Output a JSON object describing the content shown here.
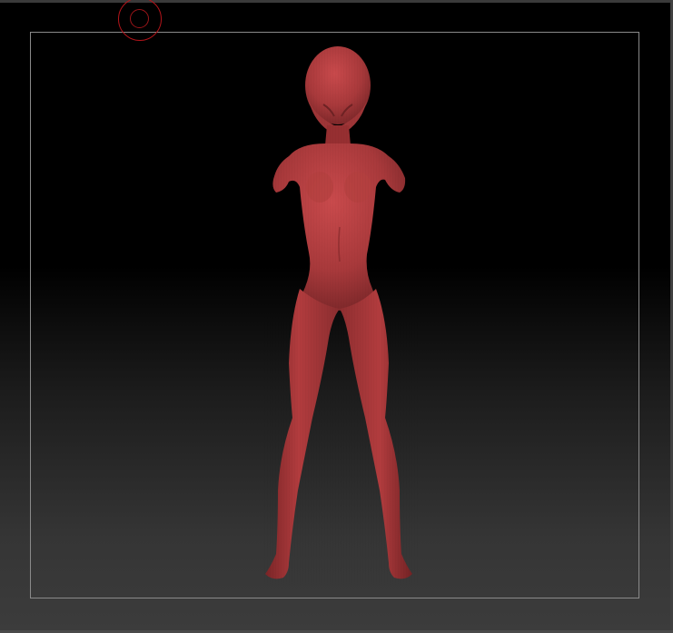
{
  "viewport": {
    "background_top": "#000000",
    "background_bottom": "#3c3c3c",
    "frame_color": "#8a8a8a"
  },
  "brush": {
    "icon": "brush-circle-cursor",
    "color": "#b3141a"
  },
  "model": {
    "icon": "female-base-mesh",
    "material_color": "#b03a3c"
  }
}
